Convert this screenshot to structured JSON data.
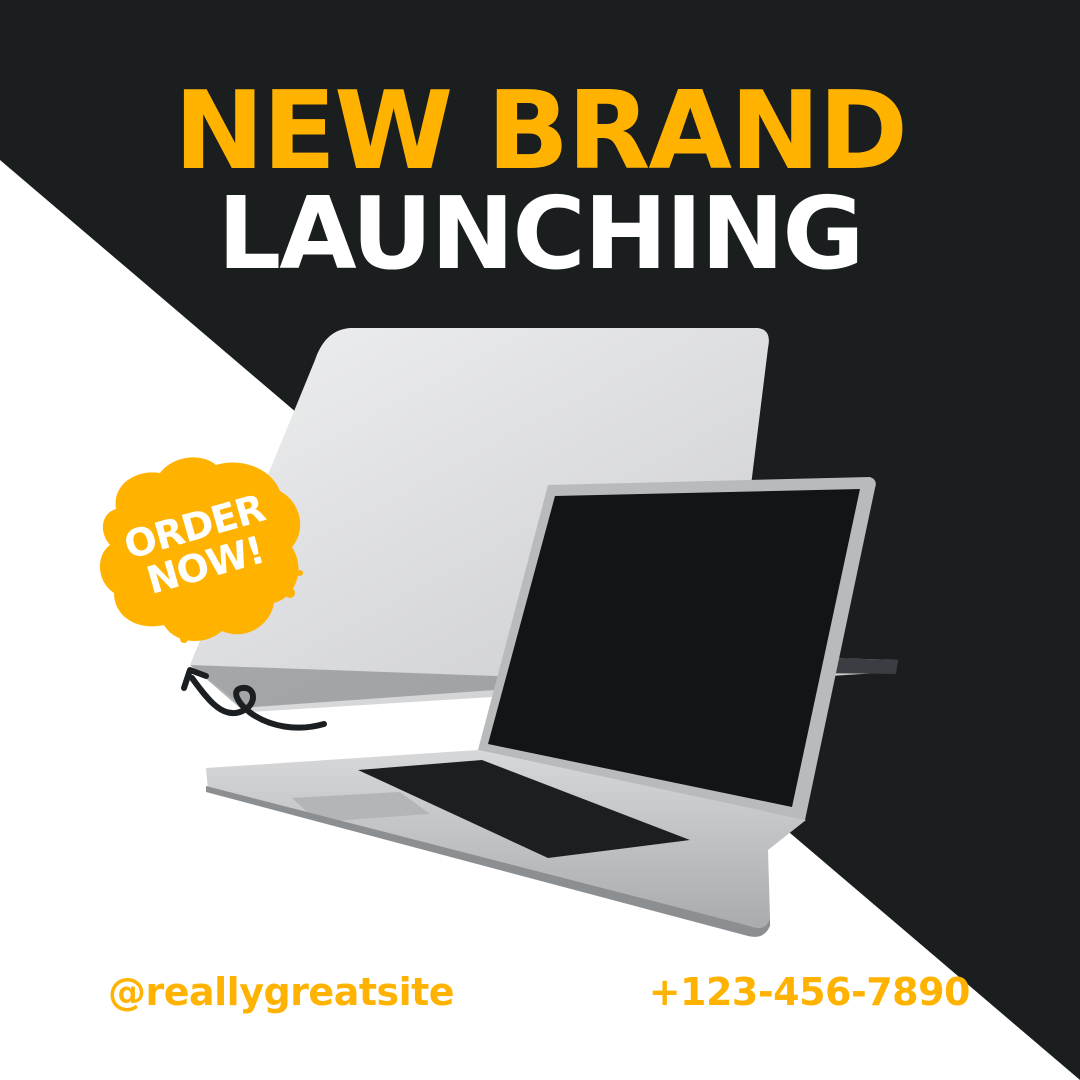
{
  "headline": {
    "line1": "NEW BRAND",
    "line2": "LAUNCHING"
  },
  "badge": {
    "text": "ORDER\nNOW!"
  },
  "footer": {
    "handle": "@reallygreatsite",
    "phone": "+123-456-7890"
  },
  "colors": {
    "accent": "#ffb300",
    "dark_background": "#1b1e1f",
    "light_background": "#ffffff"
  },
  "icons": {
    "product": "laptop-icon",
    "badge": "paint-splash-icon",
    "pointer": "curly-arrow-icon"
  }
}
